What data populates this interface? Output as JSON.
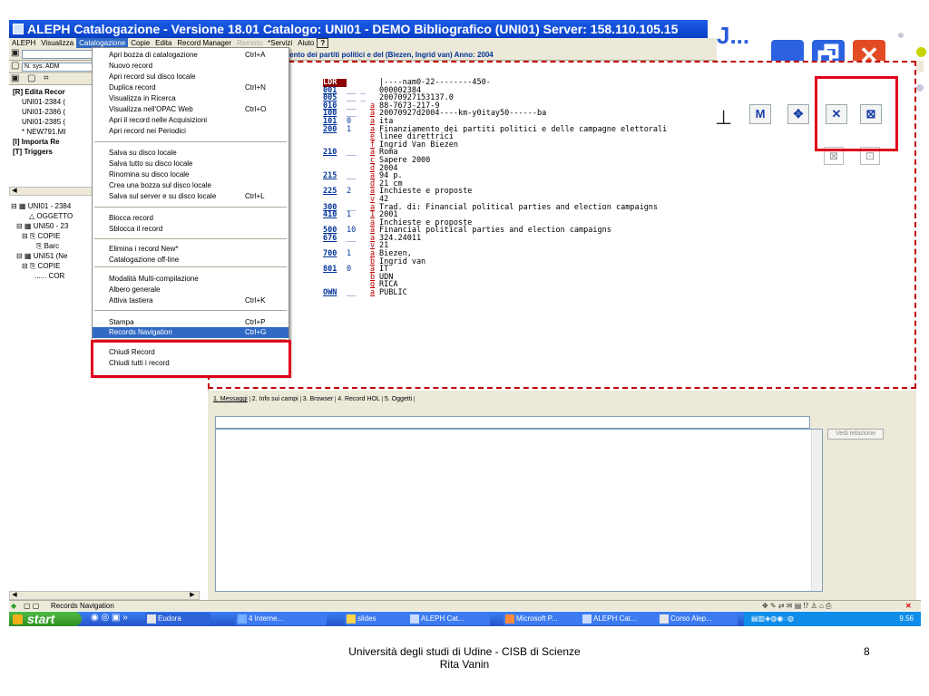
{
  "window": {
    "title": "ALEPH Catalogazione - Versione 18.01  Catalogo:  UNI01 - DEMO Bibliografico (UNI01)  Server:  158.110.105.15",
    "big_title_fragment": "J...",
    "big_min": "▁",
    "big_max": "🗗",
    "big_close": "✕"
  },
  "menubar": {
    "items": [
      {
        "label": "ALEPH",
        "state": "normal"
      },
      {
        "label": "Visualizza",
        "state": "normal"
      },
      {
        "label": "Catalogazione",
        "state": "selected"
      },
      {
        "label": "Copie",
        "state": "normal"
      },
      {
        "label": "Edita",
        "state": "normal"
      },
      {
        "label": "Record Manager",
        "state": "normal"
      },
      {
        "label": "Remoto",
        "state": "disabled"
      },
      {
        "label": "*Servizi",
        "state": "normal"
      },
      {
        "label": "Aiuto",
        "state": "normal"
      },
      {
        "label": "?",
        "state": "normal"
      }
    ]
  },
  "record_info": "mento dei partiti politici e del (Biezen, Ingrid van) Anno: 2004",
  "left_panel": {
    "search_value": "N. sys. ADM",
    "tree1": [
      {
        "text": "[R] Edita Recor",
        "bold": true,
        "indent": 4
      },
      {
        "text": "UNI01-2384 (",
        "bold": false,
        "indent": 14
      },
      {
        "text": "UNI01-2386 (",
        "bold": false,
        "indent": 14
      },
      {
        "text": "UNI01-2385 (",
        "bold": false,
        "indent": 14
      },
      {
        "text": "* NEW791.MI",
        "bold": false,
        "indent": 14
      },
      {
        "text": "[I] Importa Re",
        "bold": true,
        "indent": 4
      },
      {
        "text": "[T] Triggers",
        "bold": true,
        "indent": 4
      }
    ],
    "tree2": [
      {
        "text": "⊟ ▦ UNI01 - 2384",
        "indent": 2
      },
      {
        "text": "△ OGGETTO",
        "indent": 22
      },
      {
        "text": "⊟ ▦ UNI50 - 23",
        "indent": 8
      },
      {
        "text": "⊟ ⎘ COPIE",
        "indent": 14
      },
      {
        "text": "⎘ Barc",
        "indent": 30
      },
      {
        "text": "⊟ ▦ UNI51 (Ne",
        "indent": 8
      },
      {
        "text": "⊟ ⎘ COPIE",
        "indent": 14
      },
      {
        "text": "...... COR",
        "indent": 28
      }
    ]
  },
  "catalog_menu": {
    "items": [
      {
        "label": "Apri bozza di catalogazione",
        "shortcut": "Ctrl+A"
      },
      {
        "label": "Nuovo record",
        "shortcut": ""
      },
      {
        "label": "Apri record sul disco locale",
        "shortcut": ""
      },
      {
        "label": "Duplica record",
        "shortcut": "Ctrl+N"
      },
      {
        "label": "Visualizza in  Ricerca",
        "shortcut": ""
      },
      {
        "label": "Visualizza nell'OPAC Web",
        "shortcut": "Ctrl+O"
      },
      {
        "label": "Apri il record nelle Acquisizioni",
        "shortcut": ""
      },
      {
        "label": "Apri record nei Periodici",
        "shortcut": ""
      },
      {
        "label": "Salva su disco locale",
        "shortcut": ""
      },
      {
        "label": "Salva tutto su disco locale",
        "shortcut": ""
      },
      {
        "label": "Rinomina su disco locale",
        "shortcut": ""
      },
      {
        "label": "Crea una bozza sul disco locale",
        "shortcut": ""
      },
      {
        "label": "Salva sul server e su disco locale",
        "shortcut": "Ctrl+L"
      },
      {
        "label": "Blocca record",
        "shortcut": ""
      },
      {
        "label": "Sblocca il record",
        "shortcut": ""
      },
      {
        "label": "Elimina i record New*",
        "shortcut": ""
      },
      {
        "label": "Catalogazione off-line",
        "shortcut": ""
      },
      {
        "label": "Modalità Multi-compilazione",
        "shortcut": ""
      },
      {
        "label": "Albero generale",
        "shortcut": ""
      },
      {
        "label": "Attiva tastiera",
        "shortcut": "Ctrl+K"
      },
      {
        "label": "Stampa",
        "shortcut": "Ctrl+P"
      },
      {
        "label": "Records Navigation",
        "shortcut": "Ctrl+G"
      },
      {
        "label": "Chiudi Record",
        "shortcut": ""
      },
      {
        "label": "Chiudi tutti i record",
        "shortcut": ""
      }
    ],
    "highlighted_index": 21
  },
  "marc_lines": [
    {
      "tag": "LDR",
      "ind": "",
      "code": "",
      "text": "|----nam0-22--------450-"
    },
    {
      "tag": "001",
      "ind": "__ _",
      "code": "",
      "text": "000002384"
    },
    {
      "tag": "005",
      "ind": "__ _",
      "code": "",
      "text": "20070927153137.0"
    },
    {
      "tag": "010",
      "ind": "__",
      "code": "a",
      "text": "88-7673-217-9"
    },
    {
      "tag": "100",
      "ind": "__",
      "code": "a",
      "text": "20070927d2004----km-y0itay50------ba"
    },
    {
      "tag": "101",
      "ind": "0",
      "code": "a",
      "text": "ita"
    },
    {
      "tag": "200",
      "ind": "1",
      "code": "a",
      "text": "Finanziamento dei partiti politici e delle campagne elettorali"
    },
    {
      "tag": "",
      "ind": "",
      "code": "e",
      "text": "linee direttrici"
    },
    {
      "tag": "",
      "ind": "",
      "code": "f",
      "text": "Ingrid Van Biezen"
    },
    {
      "tag": "210",
      "ind": "__",
      "code": "a",
      "text": "Roma"
    },
    {
      "tag": "",
      "ind": "",
      "code": "c",
      "text": "Sapere 2000"
    },
    {
      "tag": "",
      "ind": "",
      "code": "d",
      "text": "2004"
    },
    {
      "tag": "215",
      "ind": "__",
      "code": "a",
      "text": "94 p."
    },
    {
      "tag": "",
      "ind": "",
      "code": "d",
      "text": "21 cm"
    },
    {
      "tag": "225",
      "ind": "2",
      "code": "a",
      "text": "Inchieste e proposte"
    },
    {
      "tag": "",
      "ind": "",
      "code": "v",
      "text": "42"
    },
    {
      "tag": "300",
      "ind": "__",
      "code": "a",
      "text": "Trad. di: Financial political parties and election campaigns"
    },
    {
      "tag": "410",
      "ind": "1",
      "code": "1",
      "text": "2001"
    },
    {
      "tag": "",
      "ind": "",
      "code": "a",
      "text": "Inchieste e proposte"
    },
    {
      "tag": "500",
      "ind": "10",
      "code": "a",
      "text": "Financial political parties and election campaigns"
    },
    {
      "tag": "676",
      "ind": "__",
      "code": "a",
      "text": "324.24011"
    },
    {
      "tag": "",
      "ind": "",
      "code": "v",
      "text": "21"
    },
    {
      "tag": "700",
      "ind": "1",
      "code": "a",
      "text": "Biezen,"
    },
    {
      "tag": "",
      "ind": "",
      "code": "b",
      "text": "Ingrid van"
    },
    {
      "tag": "801",
      "ind": "0",
      "code": "a",
      "text": "IT"
    },
    {
      "tag": "",
      "ind": "",
      "code": "b",
      "text": "UDN"
    },
    {
      "tag": "",
      "ind": "",
      "code": "g",
      "text": "RICA"
    },
    {
      "tag": "OWN",
      "ind": "__",
      "code": "a",
      "text": "PUBLIC"
    }
  ],
  "bottom_panel": {
    "tabs": [
      "1. Messaggi",
      "2. Info sui campi",
      "3. Browser",
      "4. Record HOL",
      "5. Oggetti"
    ],
    "vedi_button": "Vedi relazione"
  },
  "status": {
    "text": "Records Navigation"
  },
  "taskbar": {
    "start": "start",
    "buttons": [
      "Eudora",
      "4 Interne...",
      "slides",
      "ALEPH Cat...",
      "Microsoft P...",
      "ALEPH Cat...",
      "Corso Alep..."
    ],
    "clock": "9.56"
  },
  "slide_footer": {
    "line1": "Università degli studi di Udine - CISB di Scienze",
    "line2": "Rita Vanin",
    "page": "8"
  },
  "colors": {
    "accent": "#316ac5",
    "highlight_box": "#e0001b",
    "title_blue": "#0a3fc7",
    "bullet": "#c8d400"
  }
}
